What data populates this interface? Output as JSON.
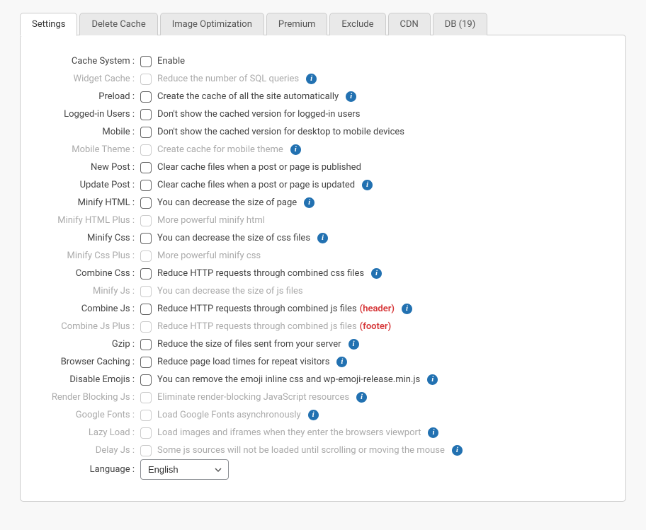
{
  "tabs": [
    {
      "label": "Settings",
      "active": true
    },
    {
      "label": "Delete Cache",
      "active": false
    },
    {
      "label": "Image Optimization",
      "active": false
    },
    {
      "label": "Premium",
      "active": false
    },
    {
      "label": "Exclude",
      "active": false
    },
    {
      "label": "CDN",
      "active": false
    },
    {
      "label": "DB (19)",
      "active": false
    }
  ],
  "settings": [
    {
      "label": "Cache System",
      "desc": "Enable",
      "info": false,
      "disabled": false,
      "extra": ""
    },
    {
      "label": "Widget Cache",
      "desc": "Reduce the number of SQL queries",
      "info": true,
      "disabled": true,
      "extra": ""
    },
    {
      "label": "Preload",
      "desc": "Create the cache of all the site automatically",
      "info": true,
      "disabled": false,
      "extra": ""
    },
    {
      "label": "Logged-in Users",
      "desc": "Don't show the cached version for logged-in users",
      "info": false,
      "disabled": false,
      "extra": ""
    },
    {
      "label": "Mobile",
      "desc": "Don't show the cached version for desktop to mobile devices",
      "info": false,
      "disabled": false,
      "extra": ""
    },
    {
      "label": "Mobile Theme",
      "desc": "Create cache for mobile theme",
      "info": true,
      "disabled": true,
      "extra": ""
    },
    {
      "label": "New Post",
      "desc": "Clear cache files when a post or page is published",
      "info": false,
      "disabled": false,
      "extra": ""
    },
    {
      "label": "Update Post",
      "desc": "Clear cache files when a post or page is updated",
      "info": true,
      "disabled": false,
      "extra": ""
    },
    {
      "label": "Minify HTML",
      "desc": "You can decrease the size of page",
      "info": true,
      "disabled": false,
      "extra": ""
    },
    {
      "label": "Minify HTML Plus",
      "desc": "More powerful minify html",
      "info": false,
      "disabled": true,
      "extra": ""
    },
    {
      "label": "Minify Css",
      "desc": "You can decrease the size of css files",
      "info": true,
      "disabled": false,
      "extra": ""
    },
    {
      "label": "Minify Css Plus",
      "desc": "More powerful minify css",
      "info": false,
      "disabled": true,
      "extra": ""
    },
    {
      "label": "Combine Css",
      "desc": "Reduce HTTP requests through combined css files",
      "info": true,
      "disabled": false,
      "extra": ""
    },
    {
      "label": "Minify Js",
      "desc": "You can decrease the size of js files",
      "info": false,
      "disabled": true,
      "extra": ""
    },
    {
      "label": "Combine Js",
      "desc": "Reduce HTTP requests through combined js files",
      "info": true,
      "disabled": false,
      "extra": "(header)"
    },
    {
      "label": "Combine Js Plus",
      "desc": "Reduce HTTP requests through combined js files",
      "info": false,
      "disabled": true,
      "extra": "(footer)"
    },
    {
      "label": "Gzip",
      "desc": "Reduce the size of files sent from your server",
      "info": true,
      "disabled": false,
      "extra": ""
    },
    {
      "label": "Browser Caching",
      "desc": "Reduce page load times for repeat visitors",
      "info": true,
      "disabled": false,
      "extra": ""
    },
    {
      "label": "Disable Emojis",
      "desc": "You can remove the emoji inline css and wp-emoji-release.min.js",
      "info": true,
      "disabled": false,
      "extra": ""
    },
    {
      "label": "Render Blocking Js",
      "desc": "Eliminate render-blocking JavaScript resources",
      "info": true,
      "disabled": true,
      "extra": ""
    },
    {
      "label": "Google Fonts",
      "desc": "Load Google Fonts asynchronously",
      "info": true,
      "disabled": true,
      "extra": ""
    },
    {
      "label": "Lazy Load",
      "desc": "Load images and iframes when they enter the browsers viewport",
      "info": true,
      "disabled": true,
      "extra": ""
    },
    {
      "label": "Delay Js",
      "desc": "Some js sources will not be loaded until scrolling or moving the mouse",
      "info": true,
      "disabled": true,
      "extra": ""
    }
  ],
  "language": {
    "label": "Language",
    "value": "English"
  }
}
